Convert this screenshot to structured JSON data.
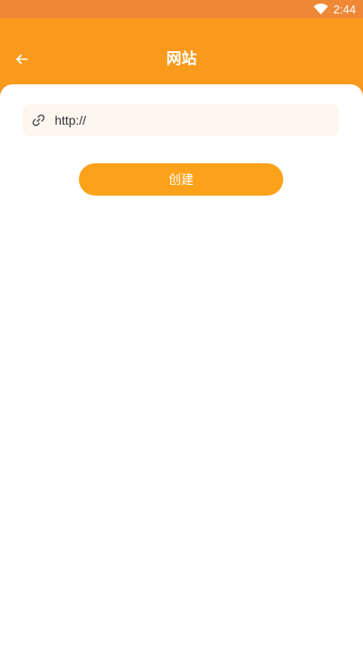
{
  "status_bar": {
    "time": "2:44",
    "wifi_icon": "wifi-icon"
  },
  "header": {
    "title": "网站",
    "back_icon": "arrow-left-icon"
  },
  "url_field": {
    "value": "http://",
    "icon": "link-icon"
  },
  "create_button": {
    "label": "创建"
  },
  "colors": {
    "status_bar_bg": "#ef8836",
    "header_bg": "#fa9a1c",
    "field_bg": "#fdf7f0",
    "button_bg": "#fba21a",
    "text_primary": "#333333"
  }
}
